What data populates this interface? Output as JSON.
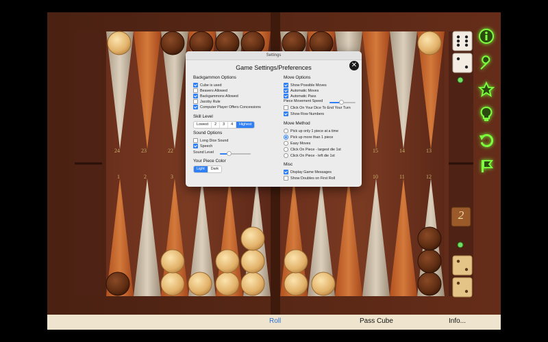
{
  "board": {
    "top_numbers": [
      "24",
      "23",
      "22",
      "15",
      "14",
      "13"
    ],
    "bottom_numbers": [
      "1",
      "2",
      "3",
      "10",
      "11",
      "12"
    ],
    "cube_value": "2"
  },
  "side_icons": [
    "info-icon",
    "wrench-icon",
    "star-icon",
    "lightbulb-icon",
    "undo-icon",
    "flag-icon"
  ],
  "bottom_bar": {
    "roll": "Roll",
    "pass_cube": "Pass Cube",
    "info": "Info..."
  },
  "dialog": {
    "window_title": "Settings",
    "heading": "Game Settings/Preferences",
    "close_glyph": "✕",
    "backgammon": {
      "title": "Backgammon Options",
      "options": [
        {
          "label": "Cube is used",
          "checked": true
        },
        {
          "label": "Beavers Allowed",
          "checked": false
        },
        {
          "label": "Backgammons Allowed",
          "checked": true
        },
        {
          "label": "Jacoby Rule",
          "checked": false
        },
        {
          "label": "Computer Player Offers Concessions",
          "checked": true
        }
      ]
    },
    "skill": {
      "title": "Skill Level",
      "levels": [
        "Lowest",
        "2",
        "3",
        "4",
        "Highest"
      ],
      "selected": "Highest"
    },
    "sound": {
      "title": "Sound Options",
      "options": [
        {
          "label": "Long Dice Sound",
          "checked": false
        },
        {
          "label": "Speech",
          "checked": true
        }
      ],
      "level_label": "Sound Level",
      "level_value": 0.3
    },
    "color": {
      "title": "Your Piece Color",
      "options": [
        "Light",
        "Dark"
      ],
      "selected": "Light"
    },
    "move": {
      "title": "Move Options",
      "options": [
        {
          "label": "Show Possible Moves",
          "checked": true
        },
        {
          "label": "Automatic Moves",
          "checked": true
        },
        {
          "label": "Automatic Pass",
          "checked": true
        }
      ],
      "speed_label": "Piece Movement Speed",
      "speed_value": 0.45,
      "options2": [
        {
          "label": "Click On Your Dice To End Your Turn",
          "checked": false
        },
        {
          "label": "Show Row Numbers",
          "checked": true
        }
      ]
    },
    "method": {
      "title": "Move Method",
      "options": [
        {
          "label": "Pick up only 1 piece at a time",
          "selected": false
        },
        {
          "label": "Pick up more than 1 piece",
          "selected": true
        },
        {
          "label": "Easy Moves",
          "selected": false
        },
        {
          "label": "Click On Piece - largest die 1st",
          "selected": false
        },
        {
          "label": "Click On Piece - left die 1st",
          "selected": false
        }
      ]
    },
    "misc": {
      "title": "Misc",
      "options": [
        {
          "label": "Display Game Messages",
          "checked": true
        },
        {
          "label": "Show Doubles on First Roll",
          "checked": false
        }
      ]
    }
  },
  "colors": {
    "accent": "#2f7ff6",
    "glow": "#6fff3a",
    "roll_text": "#2f6fd0"
  }
}
